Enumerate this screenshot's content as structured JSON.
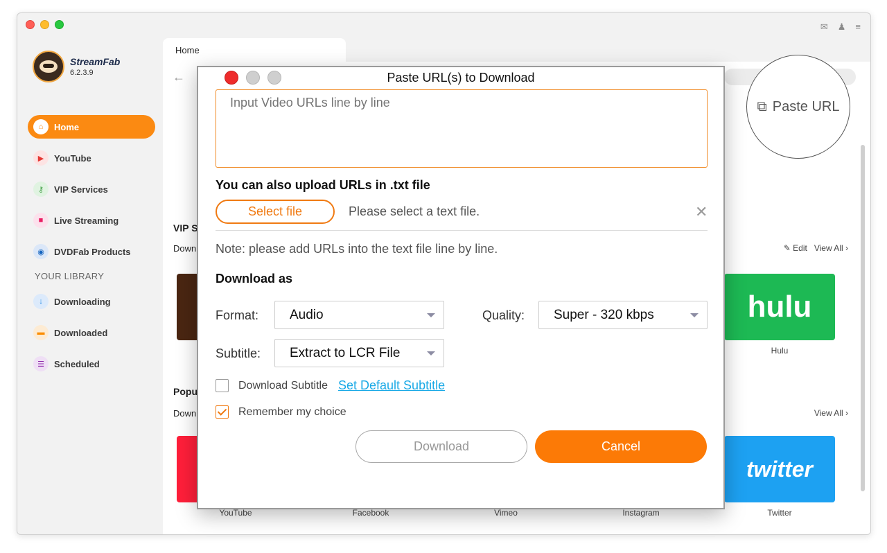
{
  "app": {
    "name": "StreamFab",
    "version": "6.2.3.9"
  },
  "topbar": {
    "icons": [
      "mail-icon",
      "shirt-icon",
      "menu-icon"
    ]
  },
  "sidebar": {
    "items": [
      {
        "label": "Home",
        "icon": "home-icon",
        "color": "#fb8a12"
      },
      {
        "label": "YouTube",
        "icon": "youtube-icon",
        "color": "#e53935"
      },
      {
        "label": "VIP Services",
        "icon": "key-icon",
        "color": "#43a047"
      },
      {
        "label": "Live Streaming",
        "icon": "camera-icon",
        "color": "#e91e63"
      },
      {
        "label": "DVDFab Products",
        "icon": "dvdfab-icon",
        "color": "#1565c0"
      }
    ],
    "library_title": "YOUR LIBRARY",
    "library": [
      {
        "label": "Downloading",
        "icon": "download-icon",
        "color": "#1e88e5"
      },
      {
        "label": "Downloaded",
        "icon": "folder-icon",
        "color": "#fb8c00"
      },
      {
        "label": "Scheduled",
        "icon": "list-icon",
        "color": "#8e24aa"
      }
    ]
  },
  "main": {
    "tab_label": "Home",
    "paste_url_label": "Paste URL",
    "section1": {
      "title": "VIP S",
      "subtitle": "Down",
      "edit_label": "Edit",
      "view_all": "View All"
    },
    "section2": {
      "title": "Popu",
      "subtitle": "Down",
      "view_all": "View All"
    },
    "hulu_tile": {
      "logo": "hulu",
      "caption": "Hulu",
      "color": "#1db954"
    },
    "twitter_tile": {
      "logo": "twitter",
      "caption": "Twitter",
      "color": "#1da1f2"
    },
    "bottom_captions": [
      "YouTube",
      "Facebook",
      "Vimeo",
      "Instagram"
    ]
  },
  "dialog": {
    "title": "Paste URL(s) to Download",
    "url_placeholder": "Input Video URLs line by line",
    "upload_title": "You can also upload URLs in .txt file",
    "select_file_label": "Select file",
    "file_placeholder": "Please select a text file.",
    "note": "Note: please add URLs into the text file line by line.",
    "download_as_title": "Download as",
    "format_label": "Format:",
    "format_value": "Audio",
    "quality_label": "Quality:",
    "quality_value": "Super - 320 kbps",
    "subtitle_label": "Subtitle:",
    "subtitle_value": "Extract to LCR File",
    "download_subtitle_label": "Download Subtitle",
    "download_subtitle_checked": false,
    "set_default_subtitle_link": "Set Default Subtitle",
    "remember_label": "Remember my choice",
    "remember_checked": true,
    "download_button": "Download",
    "cancel_button": "Cancel",
    "accent_color": "#fc7a06"
  }
}
